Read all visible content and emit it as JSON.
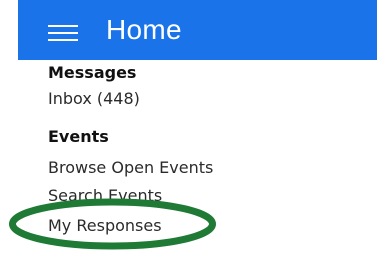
{
  "header": {
    "title": "Home",
    "color": "#1a73e8",
    "menu_icon": "hamburger-menu-icon"
  },
  "sections": {
    "messages": {
      "heading": "Messages",
      "links": [
        {
          "label": "Inbox (448)"
        }
      ]
    },
    "events": {
      "heading": "Events",
      "links": [
        {
          "label": "Browse Open Events"
        },
        {
          "label": "Search Events"
        },
        {
          "label": "My Responses"
        }
      ]
    }
  },
  "annotation": {
    "type": "ellipse-highlight",
    "color": "#1f7a35",
    "target": "My Responses"
  }
}
